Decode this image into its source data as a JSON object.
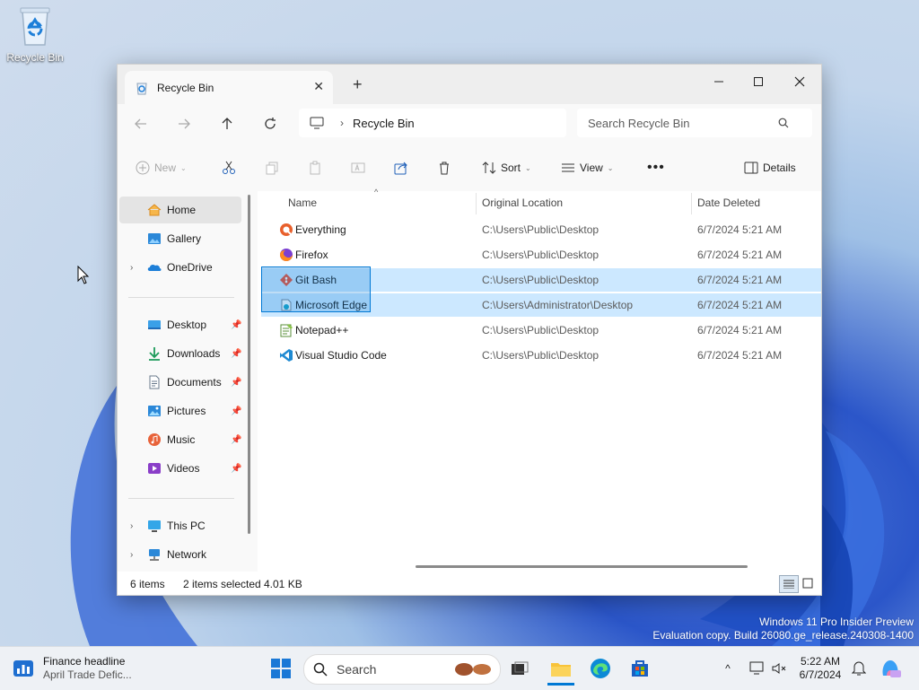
{
  "desktop": {
    "recycle_bin_label": "Recycle Bin",
    "watermark_line1": "Windows 11 Pro Insider Preview",
    "watermark_line2": "Evaluation copy. Build 26080.ge_release.240308-1400"
  },
  "window": {
    "tab_title": "Recycle Bin",
    "address_crumb": "Recycle Bin",
    "search_placeholder": "Search Recycle Bin"
  },
  "toolbar": {
    "new_label": "New",
    "sort_label": "Sort",
    "view_label": "View",
    "details_label": "Details"
  },
  "sidebar": {
    "items": [
      {
        "label": "Home",
        "icon": "home-icon"
      },
      {
        "label": "Gallery",
        "icon": "gallery-icon"
      },
      {
        "label": "OneDrive",
        "icon": "cloud-icon"
      },
      {
        "label": "Desktop",
        "icon": "desktop-folder-icon"
      },
      {
        "label": "Downloads",
        "icon": "download-icon"
      },
      {
        "label": "Documents",
        "icon": "document-icon"
      },
      {
        "label": "Pictures",
        "icon": "pictures-icon"
      },
      {
        "label": "Music",
        "icon": "music-icon"
      },
      {
        "label": "Videos",
        "icon": "video-icon"
      },
      {
        "label": "This PC",
        "icon": "computer-icon"
      },
      {
        "label": "Network",
        "icon": "network-icon"
      }
    ]
  },
  "columns": {
    "name": "Name",
    "location": "Original Location",
    "date": "Date Deleted"
  },
  "files": [
    {
      "name": "Everything",
      "location": "C:\\Users\\Public\\Desktop",
      "date": "6/7/2024 5:21 AM",
      "icon": "everything-app-icon"
    },
    {
      "name": "Firefox",
      "location": "C:\\Users\\Public\\Desktop",
      "date": "6/7/2024 5:21 AM",
      "icon": "firefox-icon"
    },
    {
      "name": "Git Bash",
      "location": "C:\\Users\\Public\\Desktop",
      "date": "6/7/2024 5:21 AM",
      "icon": "git-icon"
    },
    {
      "name": "Microsoft Edge",
      "location": "C:\\Users\\Administrator\\Desktop",
      "date": "6/7/2024 5:21 AM",
      "icon": "edge-icon"
    },
    {
      "name": "Notepad++",
      "location": "C:\\Users\\Public\\Desktop",
      "date": "6/7/2024 5:21 AM",
      "icon": "notepadpp-icon"
    },
    {
      "name": "Visual Studio Code",
      "location": "C:\\Users\\Public\\Desktop",
      "date": "6/7/2024 5:21 AM",
      "icon": "vscode-icon"
    }
  ],
  "status": {
    "count": "6 items",
    "selected": "2 items selected",
    "size": "4.01 KB"
  },
  "taskbar": {
    "news_title": "Finance headline",
    "news_sub": "April Trade Defic...",
    "search_placeholder": "Search",
    "time": "5:22 AM",
    "date": "6/7/2024"
  },
  "colors": {
    "selection": "#cce8ff",
    "accent": "#0078d4"
  }
}
